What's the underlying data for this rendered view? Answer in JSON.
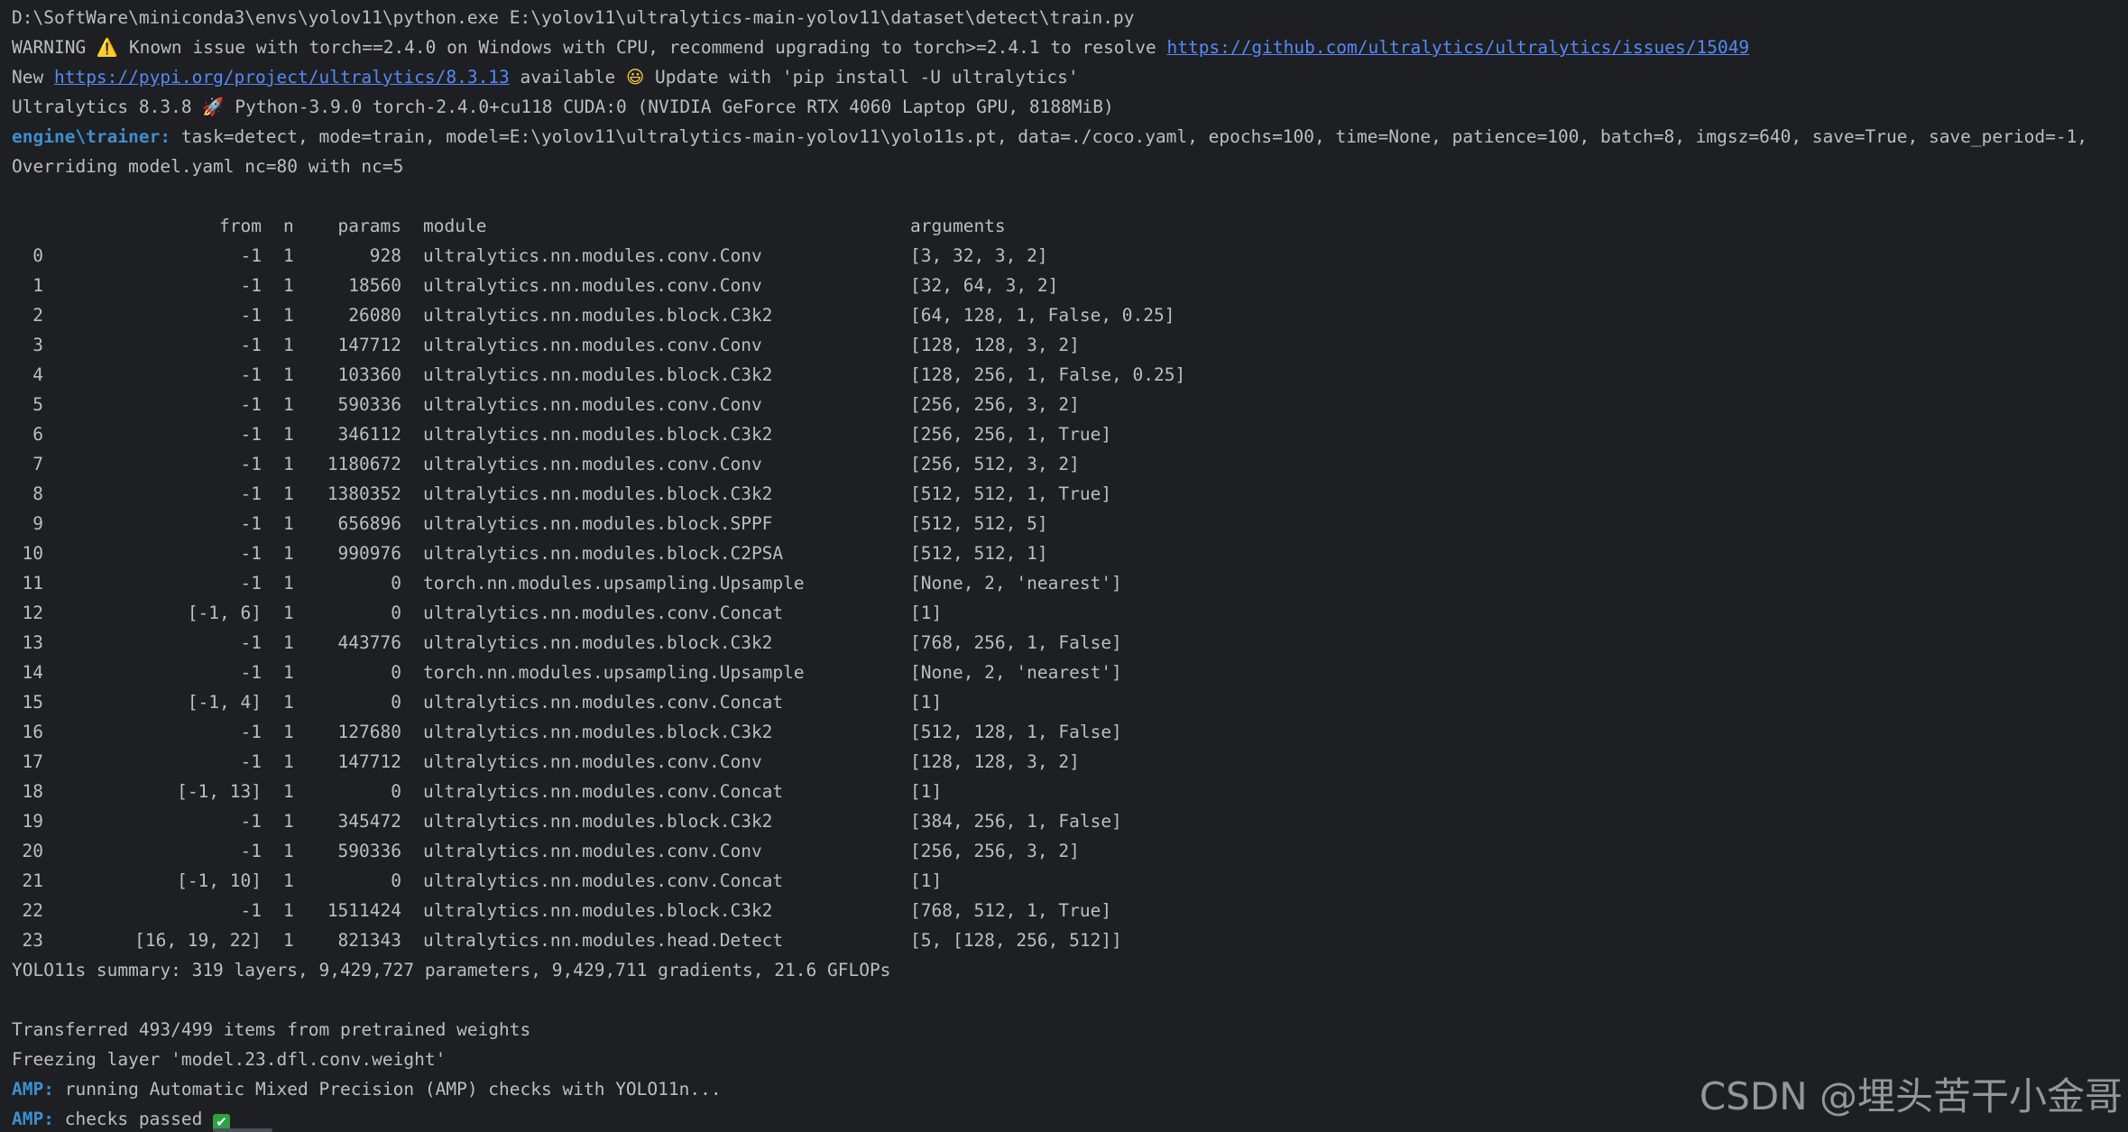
{
  "console": {
    "cmd_line": "D:\\SoftWare\\miniconda3\\envs\\yolov11\\python.exe E:\\yolov11\\ultralytics-main-yolov11\\dataset\\detect\\train.py",
    "warning": {
      "prefix": "WARNING ",
      "icon": "⚠️",
      "text": " Known issue with torch==2.4.0 on Windows with CPU, recommend upgrading to torch>=2.4.1 to resolve ",
      "link": "https://github.com/ultralytics/ultralytics/issues/15049"
    },
    "update": {
      "prefix": "New ",
      "link": "https://pypi.org/project/ultralytics/8.3.13",
      "middle": " available ",
      "icon": "😃",
      "suffix": " Update with 'pip install -U ultralytics'"
    },
    "env": {
      "prefix": "Ultralytics 8.3.8 ",
      "icon": "🚀",
      "suffix": " Python-3.9.0 torch-2.4.0+cu118 CUDA:0 (NVIDIA GeForce RTX 4060 Laptop GPU, 8188MiB)"
    },
    "trainer": {
      "label": "engine\\trainer:",
      "text": " task=detect, mode=train, model=E:\\yolov11\\ultralytics-main-yolov11\\yolo11s.pt, data=./coco.yaml, epochs=100, time=None, patience=100, batch=8, imgsz=640, save=True, save_period=-1,"
    },
    "override": "Overriding model.yaml nc=80 with nc=5",
    "table": {
      "headers": {
        "from": "from",
        "n": "n",
        "params": "params",
        "module": "module",
        "arguments": "arguments"
      },
      "rows": [
        {
          "idx": "0",
          "from": "-1",
          "n": "1",
          "params": "928",
          "module": "ultralytics.nn.modules.conv.Conv",
          "args": "[3, 32, 3, 2]"
        },
        {
          "idx": "1",
          "from": "-1",
          "n": "1",
          "params": "18560",
          "module": "ultralytics.nn.modules.conv.Conv",
          "args": "[32, 64, 3, 2]"
        },
        {
          "idx": "2",
          "from": "-1",
          "n": "1",
          "params": "26080",
          "module": "ultralytics.nn.modules.block.C3k2",
          "args": "[64, 128, 1, False, 0.25]"
        },
        {
          "idx": "3",
          "from": "-1",
          "n": "1",
          "params": "147712",
          "module": "ultralytics.nn.modules.conv.Conv",
          "args": "[128, 128, 3, 2]"
        },
        {
          "idx": "4",
          "from": "-1",
          "n": "1",
          "params": "103360",
          "module": "ultralytics.nn.modules.block.C3k2",
          "args": "[128, 256, 1, False, 0.25]"
        },
        {
          "idx": "5",
          "from": "-1",
          "n": "1",
          "params": "590336",
          "module": "ultralytics.nn.modules.conv.Conv",
          "args": "[256, 256, 3, 2]"
        },
        {
          "idx": "6",
          "from": "-1",
          "n": "1",
          "params": "346112",
          "module": "ultralytics.nn.modules.block.C3k2",
          "args": "[256, 256, 1, True]"
        },
        {
          "idx": "7",
          "from": "-1",
          "n": "1",
          "params": "1180672",
          "module": "ultralytics.nn.modules.conv.Conv",
          "args": "[256, 512, 3, 2]"
        },
        {
          "idx": "8",
          "from": "-1",
          "n": "1",
          "params": "1380352",
          "module": "ultralytics.nn.modules.block.C3k2",
          "args": "[512, 512, 1, True]"
        },
        {
          "idx": "9",
          "from": "-1",
          "n": "1",
          "params": "656896",
          "module": "ultralytics.nn.modules.block.SPPF",
          "args": "[512, 512, 5]"
        },
        {
          "idx": "10",
          "from": "-1",
          "n": "1",
          "params": "990976",
          "module": "ultralytics.nn.modules.block.C2PSA",
          "args": "[512, 512, 1]"
        },
        {
          "idx": "11",
          "from": "-1",
          "n": "1",
          "params": "0",
          "module": "torch.nn.modules.upsampling.Upsample",
          "args": "[None, 2, 'nearest']"
        },
        {
          "idx": "12",
          "from": "[-1, 6]",
          "n": "1",
          "params": "0",
          "module": "ultralytics.nn.modules.conv.Concat",
          "args": "[1]"
        },
        {
          "idx": "13",
          "from": "-1",
          "n": "1",
          "params": "443776",
          "module": "ultralytics.nn.modules.block.C3k2",
          "args": "[768, 256, 1, False]"
        },
        {
          "idx": "14",
          "from": "-1",
          "n": "1",
          "params": "0",
          "module": "torch.nn.modules.upsampling.Upsample",
          "args": "[None, 2, 'nearest']"
        },
        {
          "idx": "15",
          "from": "[-1, 4]",
          "n": "1",
          "params": "0",
          "module": "ultralytics.nn.modules.conv.Concat",
          "args": "[1]"
        },
        {
          "idx": "16",
          "from": "-1",
          "n": "1",
          "params": "127680",
          "module": "ultralytics.nn.modules.block.C3k2",
          "args": "[512, 128, 1, False]"
        },
        {
          "idx": "17",
          "from": "-1",
          "n": "1",
          "params": "147712",
          "module": "ultralytics.nn.modules.conv.Conv",
          "args": "[128, 128, 3, 2]"
        },
        {
          "idx": "18",
          "from": "[-1, 13]",
          "n": "1",
          "params": "0",
          "module": "ultralytics.nn.modules.conv.Concat",
          "args": "[1]"
        },
        {
          "idx": "19",
          "from": "-1",
          "n": "1",
          "params": "345472",
          "module": "ultralytics.nn.modules.block.C3k2",
          "args": "[384, 256, 1, False]"
        },
        {
          "idx": "20",
          "from": "-1",
          "n": "1",
          "params": "590336",
          "module": "ultralytics.nn.modules.conv.Conv",
          "args": "[256, 256, 3, 2]"
        },
        {
          "idx": "21",
          "from": "[-1, 10]",
          "n": "1",
          "params": "0",
          "module": "ultralytics.nn.modules.conv.Concat",
          "args": "[1]"
        },
        {
          "idx": "22",
          "from": "-1",
          "n": "1",
          "params": "1511424",
          "module": "ultralytics.nn.modules.block.C3k2",
          "args": "[768, 512, 1, True]"
        },
        {
          "idx": "23",
          "from": "[16, 19, 22]",
          "n": "1",
          "params": "821343",
          "module": "ultralytics.nn.modules.head.Detect",
          "args": "[5, [128, 256, 512]]"
        }
      ]
    },
    "summary": "YOLO11s summary: 319 layers, 9,429,727 parameters, 9,429,711 gradients, 21.6 GFLOPs",
    "transferred": "Transferred 493/499 items from pretrained weights",
    "freezing": "Freezing layer 'model.23.dfl.conv.weight'",
    "amp_run": {
      "label": "AMP:",
      "text": " running Automatic Mixed Precision (AMP) checks with YOLO11n..."
    },
    "amp_pass": {
      "label": "AMP:",
      "text": " checks passed ",
      "icon": "✔"
    },
    "watermark": "CSDN @埋头苦干小金哥"
  },
  "colors": {
    "background": "#1e1f22",
    "text": "#bcbec4",
    "link": "#548af7",
    "label": "#3d8fd1",
    "check": "#2ea043"
  }
}
